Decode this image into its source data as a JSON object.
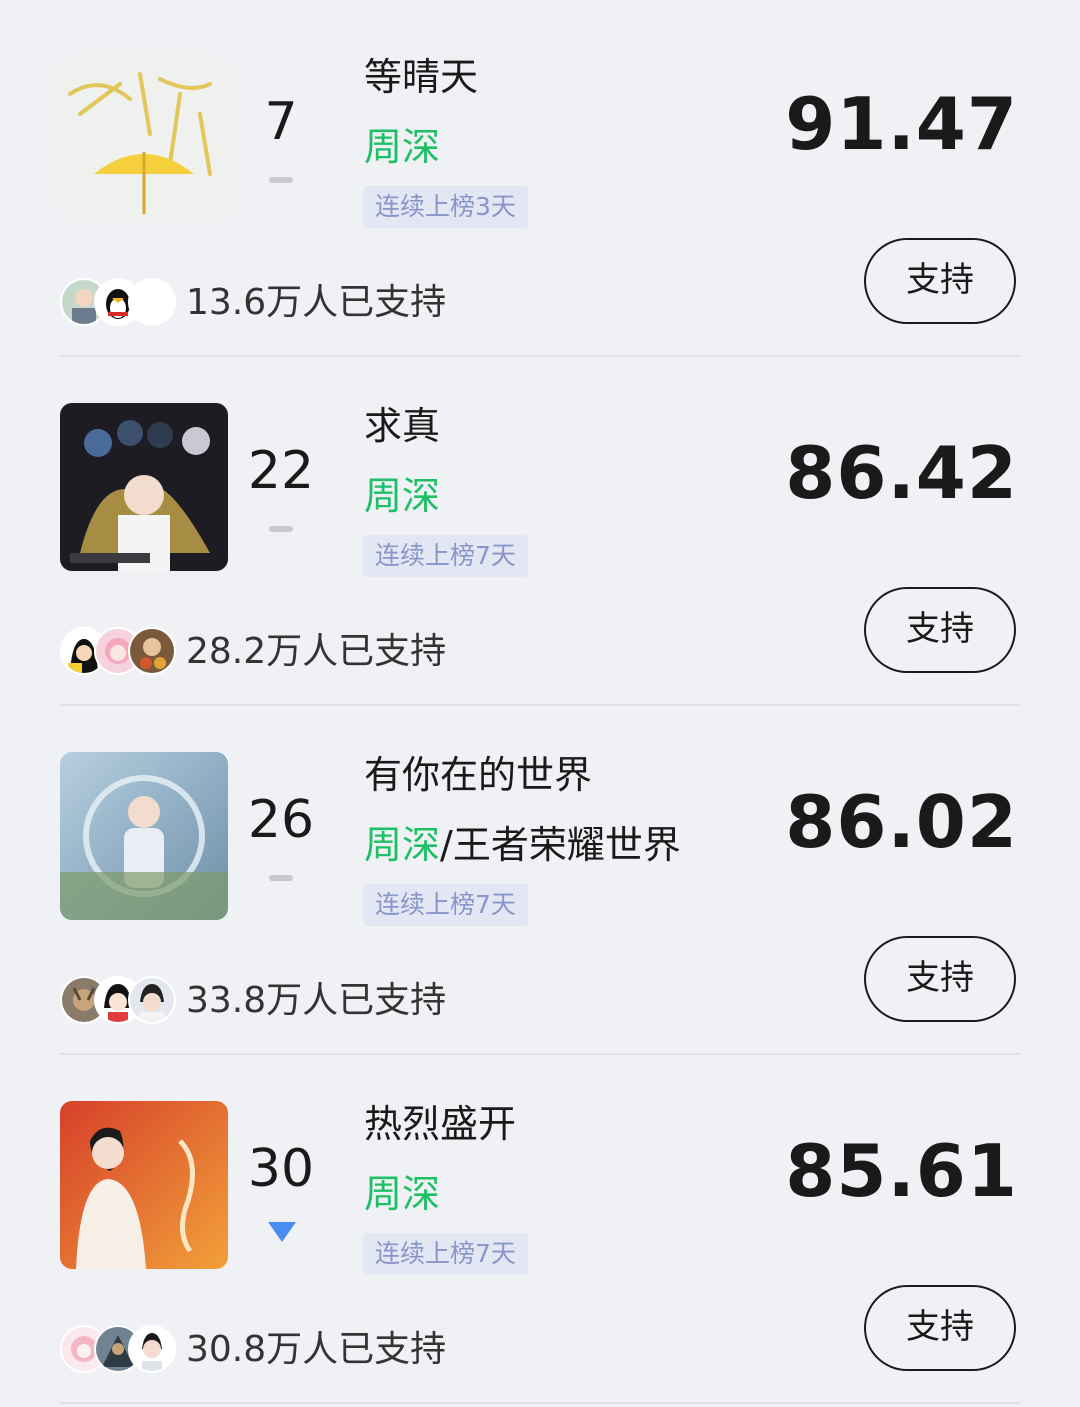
{
  "items": [
    {
      "cover_icon": "album-cover-yellow-umbrella",
      "rank": "7",
      "trend": "flat",
      "title": "等晴天",
      "artist": "周深",
      "artist_extra": "",
      "badge": "连续上榜3天",
      "score": "91.47",
      "supporters": "13.6万人已支持",
      "support_label": "支持"
    },
    {
      "cover_icon": "album-cover-anime-group",
      "rank": "22",
      "trend": "flat",
      "title": "求真",
      "artist": "周深",
      "artist_extra": "",
      "badge": "连续上榜7天",
      "score": "86.42",
      "supporters": "28.2万人已支持",
      "support_label": "支持"
    },
    {
      "cover_icon": "album-cover-fantasy-world",
      "rank": "26",
      "trend": "flat",
      "title": "有你在的世界",
      "artist": "周深",
      "artist_extra": "/王者荣耀世界",
      "badge": "连续上榜7天",
      "score": "86.02",
      "supporters": "33.8万人已支持",
      "support_label": "支持"
    },
    {
      "cover_icon": "album-cover-red-portrait",
      "rank": "30",
      "trend": "down",
      "title": "热烈盛开",
      "artist": "周深",
      "artist_extra": "",
      "badge": "连续上榜7天",
      "score": "85.61",
      "supporters": "30.8万人已支持",
      "support_label": "支持"
    }
  ],
  "colors": {
    "background": "#f0f1f5",
    "artist": "#1fbf67",
    "badge_bg": "#e3e7f3",
    "badge_text": "#8a95c9",
    "trend_down": "#4a8df0"
  }
}
